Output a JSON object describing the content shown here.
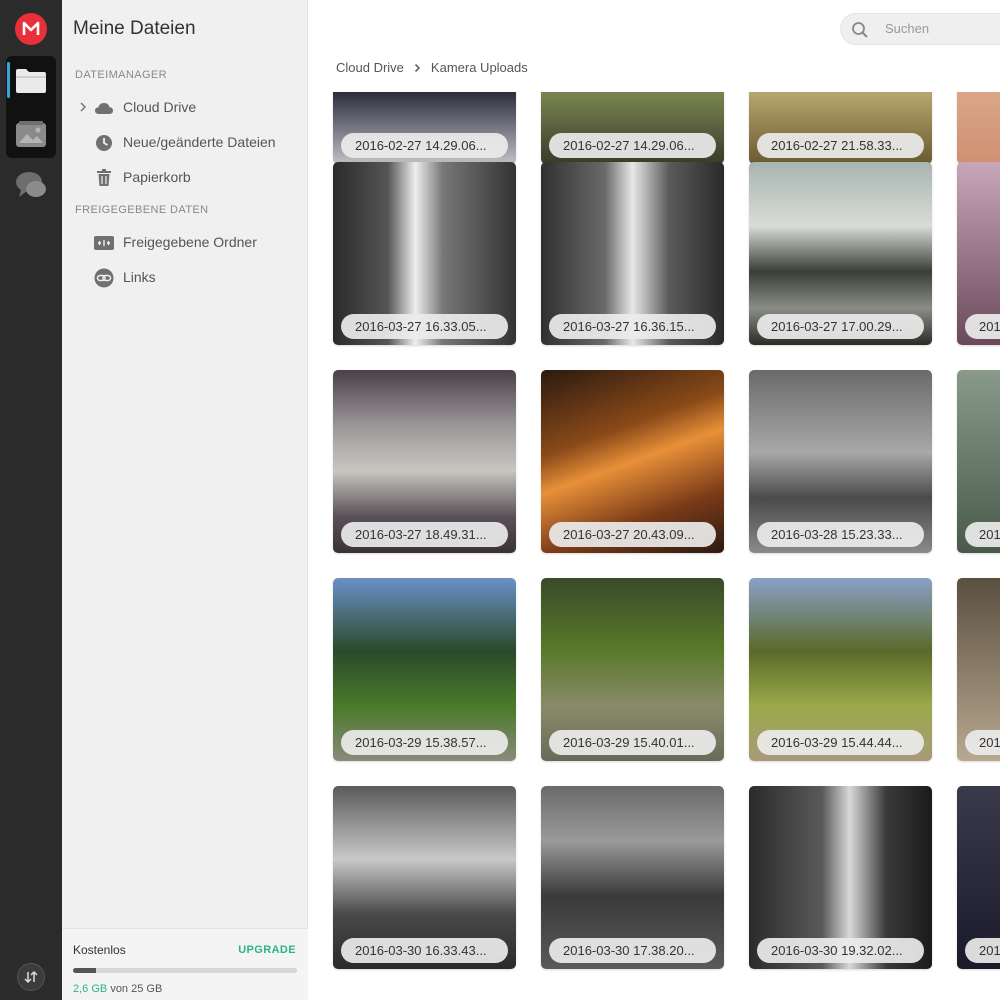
{
  "sidebar": {
    "title": "Meine Dateien",
    "section_file_manager": "DATEIMANAGER",
    "section_shared": "FREIGEGEBENE DATEN",
    "items": [
      {
        "label": "Cloud Drive",
        "icon": "cloud-icon"
      },
      {
        "label": "Neue/geänderte Dateien",
        "icon": "clock-icon"
      },
      {
        "label": "Papierkorb",
        "icon": "trash-icon"
      },
      {
        "label": "Freigegebene Ordner",
        "icon": "shared-folder-icon"
      },
      {
        "label": "Links",
        "icon": "link-icon"
      }
    ],
    "footer": {
      "plan": "Kostenlos",
      "upgrade": "UPGRADE",
      "used": "2,6 GB",
      "total": "von 25 GB",
      "usage_fraction": 0.104
    }
  },
  "search": {
    "placeholder": "Suchen"
  },
  "breadcrumb": {
    "root": "Cloud Drive",
    "current": "Kamera Uploads"
  },
  "colors": {
    "accent_green": "#2bb38a",
    "brand_red": "#e8303b",
    "rail_bg": "#2b2b2b"
  },
  "photos": [
    {
      "label": "2016-02-27 14.29.06..."
    },
    {
      "label": "2016-02-27 14.29.06..."
    },
    {
      "label": "2016-02-27 21.58.33..."
    },
    {
      "label": ""
    },
    {
      "label": "2016-03-27 16.33.05..."
    },
    {
      "label": "2016-03-27 16.36.15..."
    },
    {
      "label": "2016-03-27 17.00.29..."
    },
    {
      "label": "201"
    },
    {
      "label": "2016-03-27 18.49.31..."
    },
    {
      "label": "2016-03-27 20.43.09..."
    },
    {
      "label": "2016-03-28 15.23.33..."
    },
    {
      "label": "201"
    },
    {
      "label": "2016-03-29 15.38.57..."
    },
    {
      "label": "2016-03-29 15.40.01..."
    },
    {
      "label": "2016-03-29 15.44.44..."
    },
    {
      "label": "201"
    },
    {
      "label": "2016-03-30 16.33.43..."
    },
    {
      "label": "2016-03-30 17.38.20..."
    },
    {
      "label": "2016-03-30 19.32.02..."
    },
    {
      "label": "201"
    }
  ]
}
